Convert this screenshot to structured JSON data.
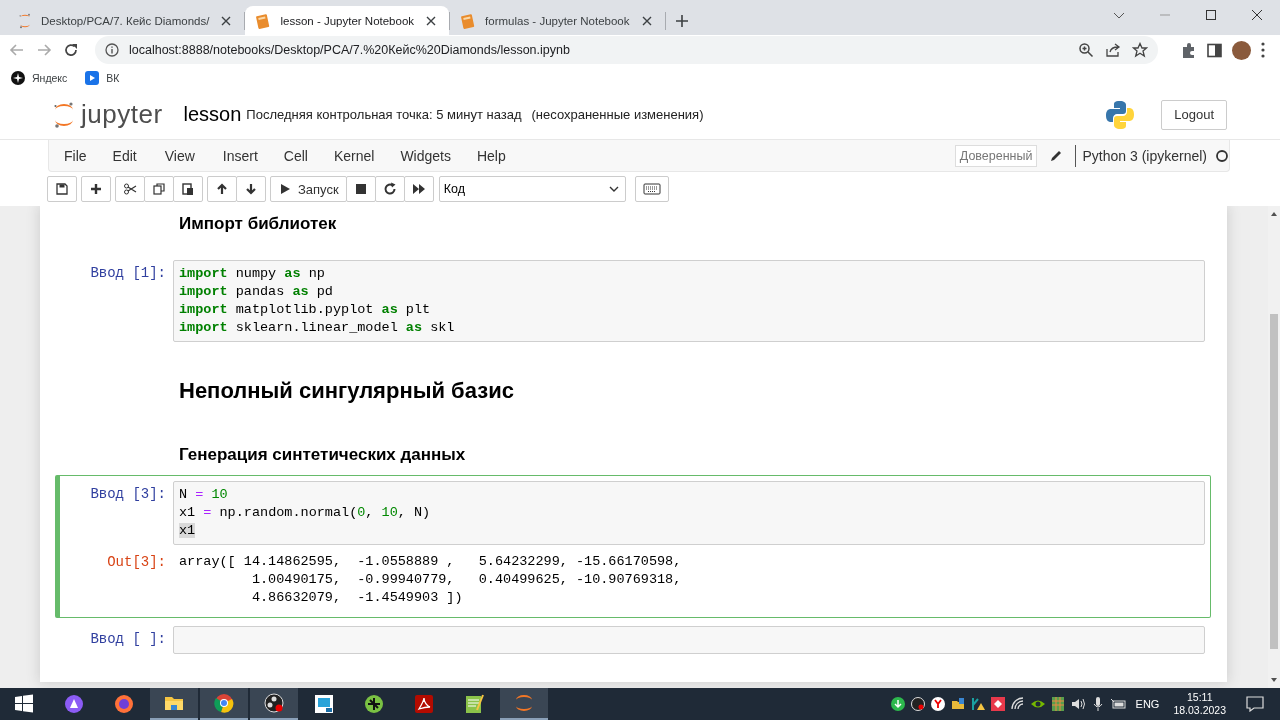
{
  "browser": {
    "tabs": [
      {
        "kind": "directory",
        "title": "Desktop/PCA/7. Кейс Diamonds/",
        "selected": false
      },
      {
        "kind": "notebook",
        "title": "lesson - Jupyter Notebook",
        "selected": true
      },
      {
        "kind": "notebook",
        "title": "formulas - Jupyter Notebook",
        "selected": false
      }
    ],
    "url": "localhost:8888/notebooks/Desktop/PCA/7.%20Кейс%20Diamonds/lesson.ipynb",
    "bookmarks": [
      {
        "label": "Яндекс"
      },
      {
        "label": "ВК"
      }
    ]
  },
  "jupyter": {
    "logo_text": "jupyter",
    "notebook_name": "lesson",
    "checkpoint": "Последняя контрольная точка: 5 минут назад",
    "unsaved": "(несохраненные изменения)",
    "logout": "Logout",
    "menu": [
      "File",
      "Edit",
      "View",
      "Insert",
      "Cell",
      "Kernel",
      "Widgets",
      "Help"
    ],
    "trusted": "Доверенный",
    "kernel": "Python 3 (ipykernel)",
    "kernel_busy": false,
    "toolbar": {
      "run": "Запуск",
      "cell_type": "Код"
    }
  },
  "cells": [
    {
      "kind": "subtitle",
      "text": "Импорт библиотек",
      "selected": false
    },
    {
      "kind": "code",
      "prompt": "Ввод [1]:",
      "selected": false,
      "lines": [
        [
          {
            "kind": "kw",
            "text": "import"
          },
          {
            "kind": "plain",
            "text": " numpy "
          },
          {
            "kind": "kw",
            "text": "as"
          },
          {
            "kind": "plain",
            "text": " np"
          }
        ],
        [
          {
            "kind": "kw",
            "text": "import"
          },
          {
            "kind": "plain",
            "text": " pandas "
          },
          {
            "kind": "kw",
            "text": "as"
          },
          {
            "kind": "plain",
            "text": " pd"
          }
        ],
        [
          {
            "kind": "kw",
            "text": "import"
          },
          {
            "kind": "plain",
            "text": " matplotlib.pyplot "
          },
          {
            "kind": "kw",
            "text": "as"
          },
          {
            "kind": "plain",
            "text": " plt"
          }
        ],
        [
          {
            "kind": "kw",
            "text": "import"
          },
          {
            "kind": "plain",
            "text": " sklearn.linear_model "
          },
          {
            "kind": "kw",
            "text": "as"
          },
          {
            "kind": "plain",
            "text": " skl"
          }
        ]
      ]
    },
    {
      "kind": "title",
      "text": "Неполный сингулярный базис",
      "selected": false
    },
    {
      "kind": "subtitle",
      "text": "Генерация синтетических данных",
      "selected": false
    },
    {
      "kind": "code",
      "prompt": "Ввод [3]:",
      "selected": true,
      "lines": [
        [
          {
            "kind": "plain",
            "text": "N "
          },
          {
            "kind": "op",
            "text": "="
          },
          {
            "kind": "num",
            "text": " 10"
          }
        ],
        [
          {
            "kind": "plain",
            "text": "x1 "
          },
          {
            "kind": "op",
            "text": "="
          },
          {
            "kind": "plain",
            "text": " np.random.normal("
          },
          {
            "kind": "num",
            "text": "0"
          },
          {
            "kind": "plain",
            "text": ", "
          },
          {
            "kind": "num",
            "text": "10"
          },
          {
            "kind": "plain",
            "text": ", N)"
          }
        ],
        [
          {
            "kind": "highlight",
            "text": "x1"
          }
        ]
      ],
      "output": {
        "prompt": "Out[3]:",
        "lines": [
          "array([ 14.14862595,  -1.0558889 ,   5.64232299, -15.66170598,",
          "         1.00490175,  -0.99940779,   0.40499625, -10.90769318,",
          "         4.86632079,  -1.4549903 ])"
        ]
      }
    },
    {
      "kind": "code",
      "prompt": "Ввод [ ]:",
      "selected": false
    }
  ],
  "taskbar": {
    "apps": [
      {
        "running": false
      },
      {
        "running": false
      },
      {
        "running": false
      },
      {
        "running": true
      },
      {
        "running": true
      },
      {
        "running": true
      },
      {
        "running": false
      },
      {
        "running": false
      },
      {
        "running": false
      },
      {
        "running": false
      },
      {
        "running": true
      }
    ],
    "language": "ENG",
    "time": "15:11",
    "date": "18.03.2023"
  }
}
